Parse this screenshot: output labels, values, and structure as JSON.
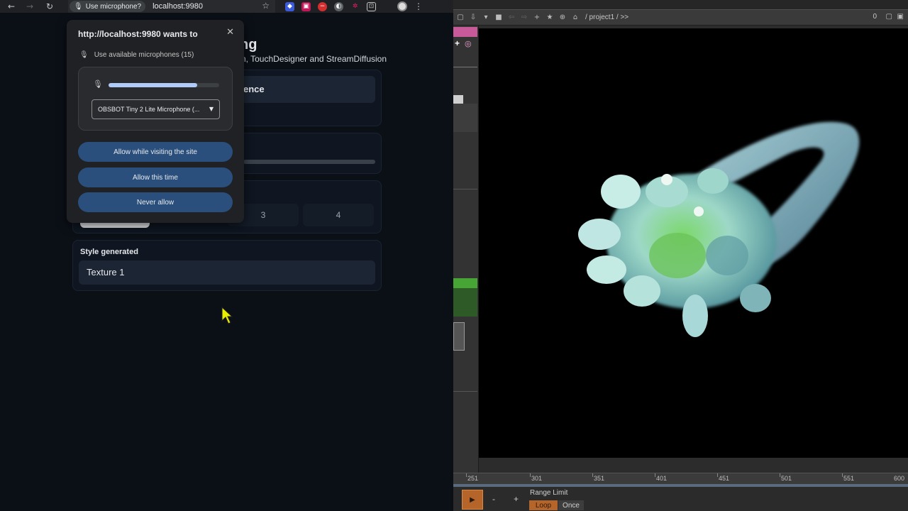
{
  "browser": {
    "permission_chip": "Use microphone?",
    "url": "localhost:9980"
  },
  "page": {
    "title_fragment": "ng",
    "subtitle_fragment": "n, TouchDesigner and StreamDiffusion",
    "card1_text_fragment": "ence",
    "number_buttons": [
      "3",
      "4"
    ],
    "style_generated_label": "Style generated",
    "style_value": "Texture 1"
  },
  "popup": {
    "title": "http://localhost:9980 wants to",
    "mic_row": "Use available microphones (15)",
    "mic_level": 0.8,
    "selected_microphone": "OBSBOT Tiny 2 Lite Microphone (...",
    "buttons": {
      "allow_visit": "Allow while visiting the site",
      "allow_once": "Allow this time",
      "never": "Never allow"
    }
  },
  "td": {
    "path": "/ project1 / >>",
    "counter": "0",
    "timeline_ticks": [
      "251",
      "301",
      "351",
      "401",
      "451",
      "501",
      "551",
      "600"
    ],
    "range_limit": "Range Limit",
    "loop": "Loop",
    "once": "Once",
    "minus": "-",
    "plus": "+"
  },
  "colors": {
    "accent_button": "#2a4f7c",
    "td_orange": "#b5652a",
    "cursor_yellow": "#e8f000"
  }
}
